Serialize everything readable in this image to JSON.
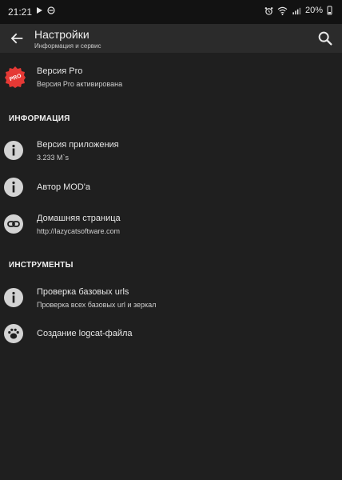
{
  "statusbar": {
    "time": "21:21",
    "battery_percent": "20%"
  },
  "toolbar": {
    "title": "Настройки",
    "subtitle": "Информация и сервис"
  },
  "pro": {
    "title": "Версия Pro",
    "subtitle": "Версия Pro активирована",
    "badge_text": "PRO",
    "badge_color": "#e53935"
  },
  "sections": {
    "info": "ИНФОРМАЦИЯ",
    "tools": "ИНСТРУМЕНТЫ"
  },
  "items": {
    "app_version": {
      "title": "Версия приложения",
      "subtitle": "3.233 M`s"
    },
    "mod_author": {
      "title": "Автор MOD'a"
    },
    "homepage": {
      "title": "Домашняя страница",
      "subtitle": "http://lazycatsoftware.com"
    },
    "check_urls": {
      "title": "Проверка базовых urls",
      "subtitle": "Проверка всех базовых url и зеркал"
    },
    "logcat": {
      "title": "Создание logcat-файла"
    }
  },
  "icons": {
    "back": "arrow-back-icon",
    "search": "search-icon",
    "info": "info-icon",
    "link": "link-icon",
    "paw": "paw-icon"
  }
}
